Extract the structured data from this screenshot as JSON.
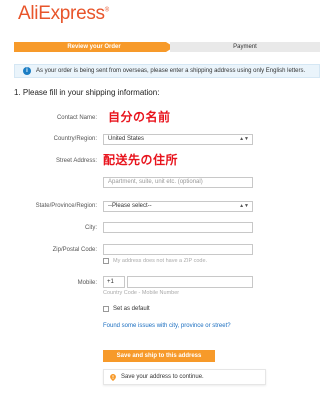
{
  "brand": {
    "name": "AliExpress",
    "mark": "®",
    "color": "#e8552b"
  },
  "steps": [
    {
      "label": "Review your Order",
      "active": true
    },
    {
      "label": "Payment",
      "active": false
    }
  ],
  "notice": {
    "icon": "info-icon",
    "text": "As your order is being sent from overseas, please enter a shipping address using only English letters."
  },
  "section_title": "1. Please fill in your shipping information:",
  "form": {
    "contact_name": {
      "label": "Contact Name:",
      "overlay": "自分の名前"
    },
    "country": {
      "label": "Country/Region:",
      "value": "United States"
    },
    "street": {
      "label": "Street Address:",
      "overlay": "配送先の住所",
      "placeholder2": "Apartment, suite, unit etc. (optional)"
    },
    "state": {
      "label": "State/Province/Region:",
      "value": "--Please select--"
    },
    "city": {
      "label": "City:"
    },
    "zip": {
      "label": "Zip/Postal Code:",
      "no_zip": "My address does not have a ZIP code."
    },
    "mobile": {
      "label": "Mobile:",
      "code": "+1",
      "hint": "Country Code - Mobile Number"
    },
    "set_default": "Set as default",
    "issues_link": "Found some issues with city, province or street?"
  },
  "save_button": "Save and ship to this address",
  "tip": {
    "text": "Save your address to continue."
  },
  "colors": {
    "accent": "#f79a2a",
    "link": "#1a6ec0",
    "overlay_red": "#e8131c"
  }
}
